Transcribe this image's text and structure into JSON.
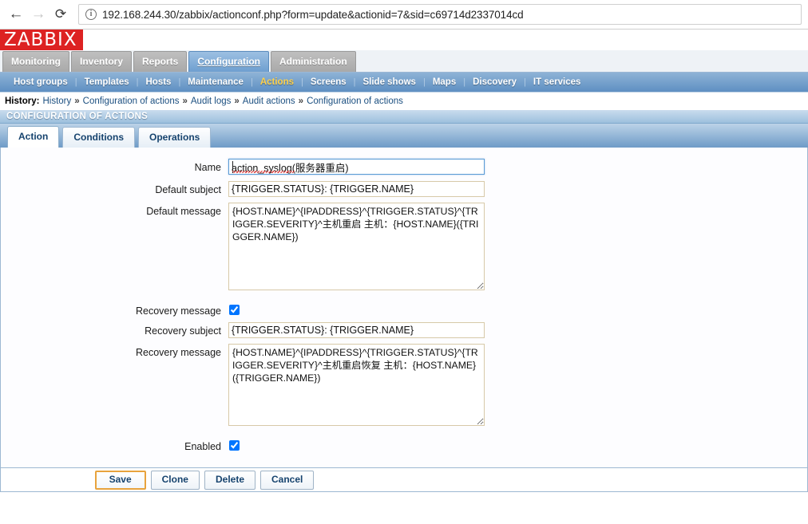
{
  "browser": {
    "back_icon": "arrow-left-icon",
    "forward_icon": "arrow-right-icon",
    "reload_icon": "reload-icon",
    "info_icon": "info-circle-icon",
    "url": "192.168.244.30/zabbix/actionconf.php?form=update&actionid=7&sid=c69714d2337014cd"
  },
  "branding": {
    "logo_text": "ZABBIX",
    "logo_bg": "#dd2222",
    "logo_color": "#ffffff"
  },
  "main_menu": {
    "items": [
      {
        "label": "Monitoring",
        "active": false
      },
      {
        "label": "Inventory",
        "active": false
      },
      {
        "label": "Reports",
        "active": false
      },
      {
        "label": "Configuration",
        "active": true
      },
      {
        "label": "Administration",
        "active": false
      }
    ],
    "active_color": "#6e9fd0"
  },
  "sub_menu": {
    "items": [
      {
        "label": "Host groups",
        "active": false
      },
      {
        "label": "Templates",
        "active": false
      },
      {
        "label": "Hosts",
        "active": false
      },
      {
        "label": "Maintenance",
        "active": false
      },
      {
        "label": "Actions",
        "active": true
      },
      {
        "label": "Screens",
        "active": false
      },
      {
        "label": "Slide shows",
        "active": false
      },
      {
        "label": "Maps",
        "active": false
      },
      {
        "label": "Discovery",
        "active": false
      },
      {
        "label": "IT services",
        "active": false
      }
    ],
    "active_color": "#ffd24d",
    "separator": "|"
  },
  "history": {
    "label": "History:",
    "arrow": "»",
    "items": [
      "History",
      "Configuration of actions",
      "Audit logs",
      "Audit actions",
      "Configuration of actions"
    ]
  },
  "page_title": "CONFIGURATION OF ACTIONS",
  "tabs": [
    {
      "label": "Action",
      "active": true
    },
    {
      "label": "Conditions",
      "active": false
    },
    {
      "label": "Operations",
      "active": false
    }
  ],
  "form": {
    "name": {
      "label": "Name",
      "value": "action_syslog(服务器重启)",
      "focused": true
    },
    "default_subject": {
      "label": "Default subject",
      "value": "{TRIGGER.STATUS}: {TRIGGER.NAME}"
    },
    "default_message": {
      "label": "Default message",
      "value": "{HOST.NAME}^{IPADDRESS}^{TRIGGER.STATUS}^{TRIGGER.SEVERITY}^主机重启 主机：{HOST.NAME}({TRIGGER.NAME})"
    },
    "recovery_message_toggle": {
      "label": "Recovery message",
      "checked": true
    },
    "recovery_subject": {
      "label": "Recovery subject",
      "value": "{TRIGGER.STATUS}: {TRIGGER.NAME}"
    },
    "recovery_message": {
      "label": "Recovery message",
      "value": "{HOST.NAME}^{IPADDRESS}^{TRIGGER.STATUS}^{TRIGGER.SEVERITY}^主机重启恢复 主机：{HOST.NAME}({TRIGGER.NAME})"
    },
    "enabled": {
      "label": "Enabled",
      "checked": true
    }
  },
  "footer_buttons": [
    {
      "label": "Save",
      "primary": true
    },
    {
      "label": "Clone",
      "primary": false
    },
    {
      "label": "Delete",
      "primary": false
    },
    {
      "label": "Cancel",
      "primary": false
    }
  ]
}
